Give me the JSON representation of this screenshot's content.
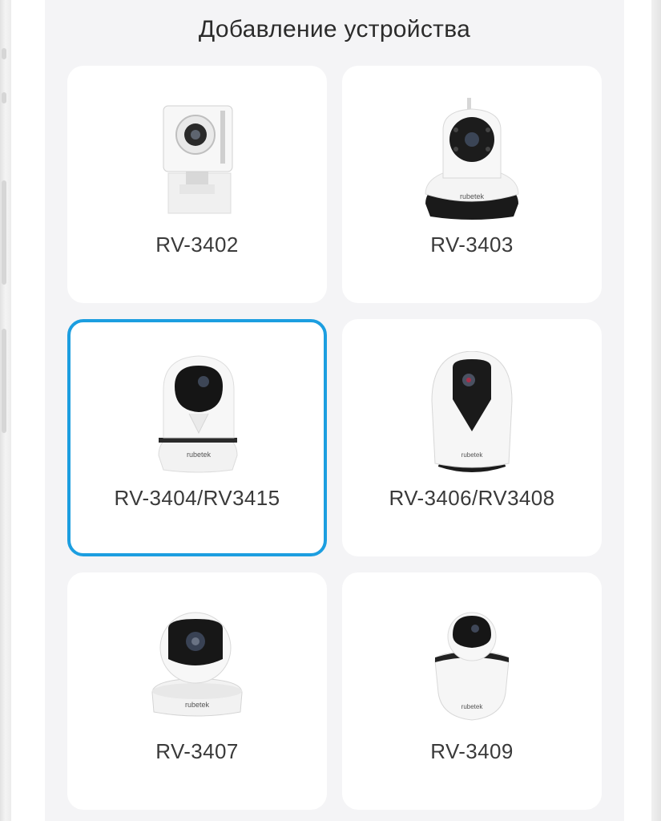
{
  "header": {
    "title": "Добавление устройства"
  },
  "devices": [
    {
      "label": "RV-3402",
      "icon": "square-camera-icon",
      "selected": false
    },
    {
      "label": "RV-3403",
      "icon": "ptz-antenna-camera-icon",
      "selected": false
    },
    {
      "label": "RV-3404/RV3415",
      "icon": "dome-camera-icon",
      "selected": true
    },
    {
      "label": "RV-3406/RV3408",
      "icon": "egg-camera-icon",
      "selected": false
    },
    {
      "label": "RV-3407",
      "icon": "ball-camera-icon",
      "selected": false
    },
    {
      "label": "RV-3409",
      "icon": "round-ptz-camera-icon",
      "selected": false
    }
  ],
  "brand": "rubetek",
  "colors": {
    "selection": "#1c9ee0",
    "background": "#f4f4f6",
    "card": "#ffffff"
  }
}
